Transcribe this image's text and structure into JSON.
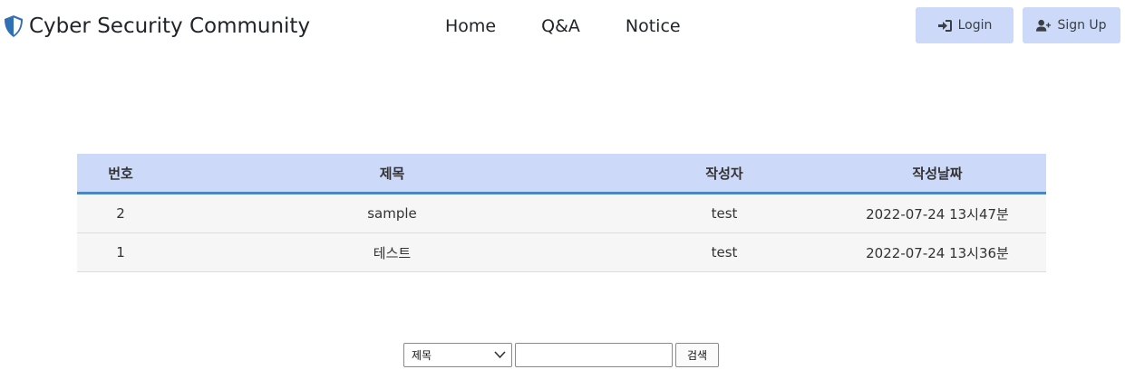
{
  "nav": {
    "brand": "Cyber Security Community",
    "links": [
      "Home",
      "Q&A",
      "Notice"
    ],
    "login_label": "Login",
    "signup_label": "Sign Up",
    "brand_icon": "shield-icon",
    "accent_color": "#cdd9f8",
    "brand_color": "#2f6fb3"
  },
  "board": {
    "headers": [
      "번호",
      "제목",
      "작성자",
      "작성날짜"
    ],
    "rows": [
      [
        "2",
        "sample",
        "test",
        "2022-07-24 13시47분"
      ],
      [
        "1",
        "테스트",
        "test",
        "2022-07-24 13시36분"
      ]
    ]
  },
  "search": {
    "field_value": "제목",
    "input_value": "",
    "button_label": "검색"
  }
}
